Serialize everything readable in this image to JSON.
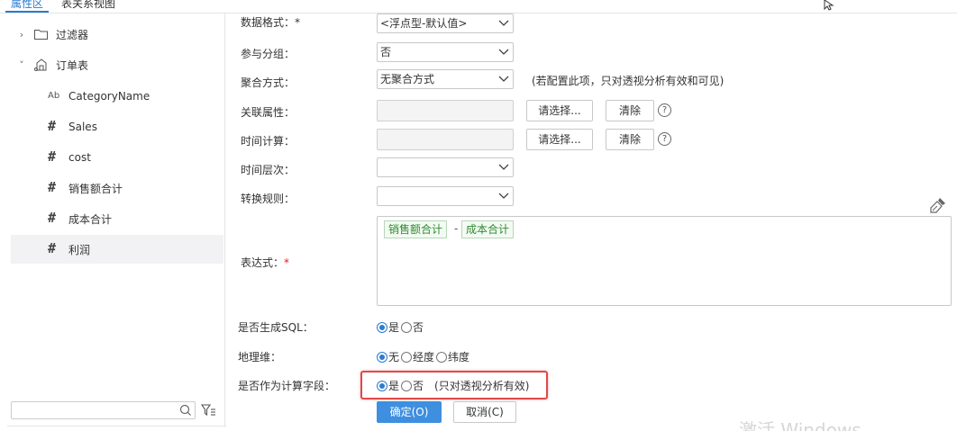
{
  "tabs": [
    "属性区",
    "表关系视图"
  ],
  "tree": {
    "filter_label": "过滤器",
    "table_label": "订单表",
    "fields": [
      {
        "type": "text",
        "label": "CategoryName"
      },
      {
        "type": "number",
        "label": "Sales"
      },
      {
        "type": "number",
        "label": "cost"
      },
      {
        "type": "number",
        "label": "销售额合计"
      },
      {
        "type": "number",
        "label": "成本合计"
      },
      {
        "type": "number",
        "label": "利润",
        "selected": true
      }
    ],
    "search_placeholder": ""
  },
  "form": {
    "data_format": {
      "label": "数据格式：*",
      "value": "<浮点型-默认值>"
    },
    "group": {
      "label": "参与分组：",
      "value": "否"
    },
    "aggregation": {
      "label": "聚合方式：",
      "value": "无聚合方式",
      "hint": "(若配置此项，只对透视分析有效和可见)"
    },
    "related_attr": {
      "label": "关联属性：",
      "choose": "请选择...",
      "clear": "清除"
    },
    "time_calc": {
      "label": "时间计算：",
      "choose": "请选择...",
      "clear": "清除"
    },
    "time_level": {
      "label": "时间层次：",
      "value": ""
    },
    "convert_rule": {
      "label": "转换规则：",
      "value": ""
    },
    "expression": {
      "label": "表达式：",
      "required_mark": "*",
      "tokens": [
        "销售额合计",
        "-",
        "成本合计"
      ]
    },
    "gen_sql": {
      "label": "是否生成SQL：",
      "options": [
        "是",
        "否"
      ],
      "selected": 0
    },
    "geo": {
      "label": "地理维：",
      "options": [
        "无",
        "经度",
        "纬度"
      ],
      "selected": 0
    },
    "calc_field": {
      "label": "是否作为计算字段：",
      "options": [
        "是",
        "否"
      ],
      "selected": 0,
      "hint": "(只对透视分析有效)"
    }
  },
  "buttons": {
    "ok": "确定(O)",
    "cancel": "取消(C)"
  },
  "watermark": "激活 Windows",
  "colors": {
    "accent": "#2b7bd0",
    "highlight": "#e04848",
    "chip_text": "#2e8b2e"
  }
}
